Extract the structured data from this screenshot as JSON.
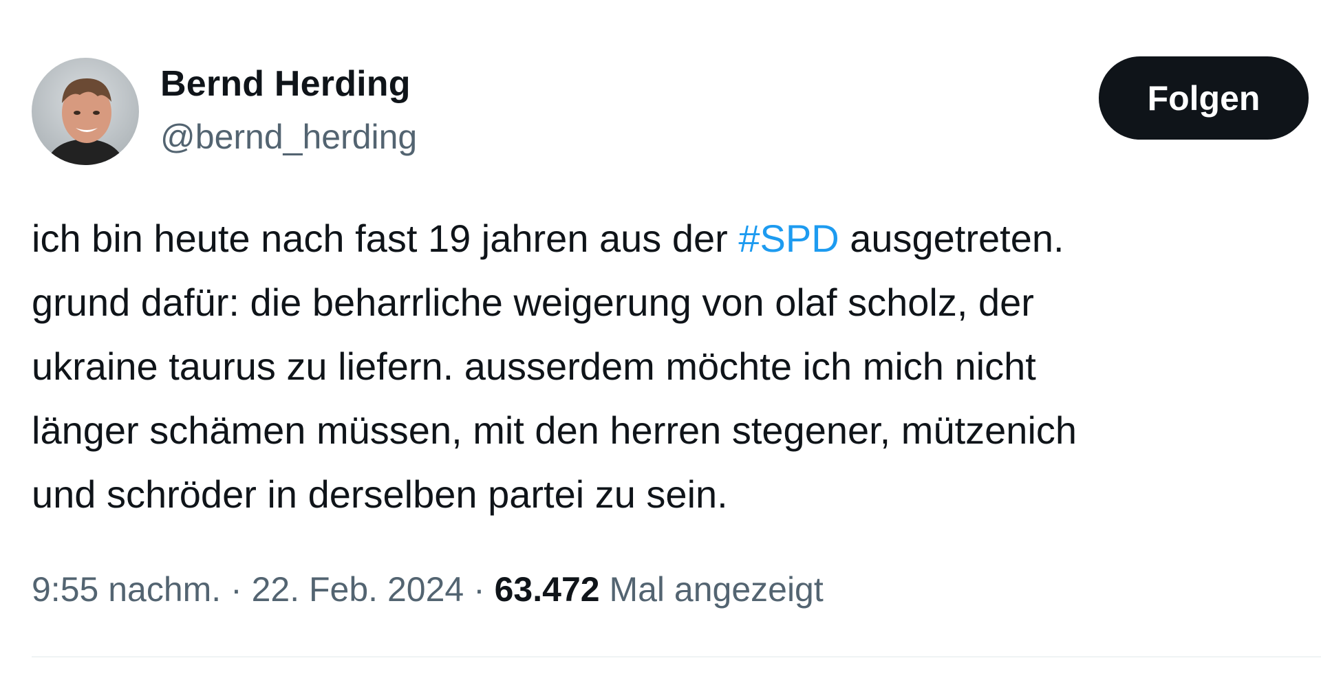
{
  "author": {
    "name": "Bernd Herding",
    "handle": "@bernd_herding",
    "avatar_icon": "profile-photo"
  },
  "follow_label": "Folgen",
  "tweet": {
    "line1_before": "ich bin heute nach fast 19 jahren aus der ",
    "hashtag": "#SPD",
    "line1_after": " ausgetreten.",
    "line2": "grund dafür: die beharrliche weigerung von olaf scholz, der",
    "line3": "ukraine taurus zu liefern. ausserdem möchte ich mich nicht",
    "line4": "länger schämen müssen, mit den herren stegener, mützenich",
    "line5": "und schröder in derselben partei zu sein."
  },
  "meta": {
    "time": "9:55 nachm.",
    "separator": " · ",
    "date": "22. Feb. 2024",
    "views_count": "63.472",
    "views_label": " Mal angezeigt"
  },
  "colors": {
    "text": "#0f1419",
    "secondary": "#536471",
    "link": "#1d9bf0",
    "button": "#0f1419"
  }
}
